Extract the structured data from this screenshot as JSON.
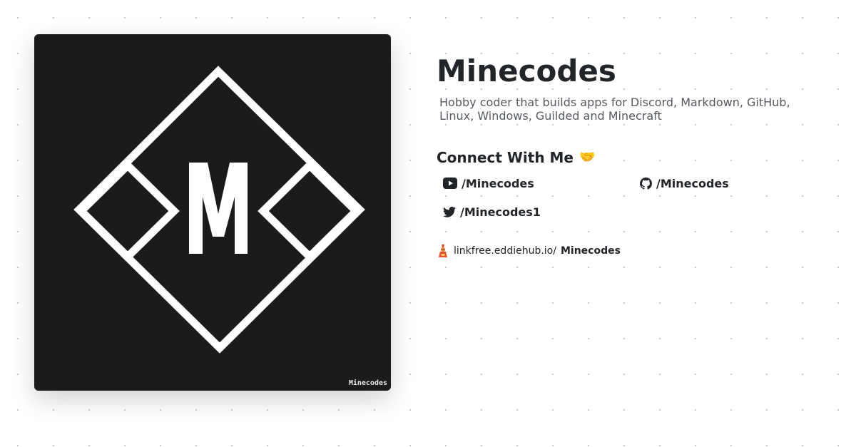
{
  "avatar": {
    "watermark": "Minecodes",
    "logo_letter": "M",
    "background_color": "#1b1b1b",
    "foreground_color": "#ffffff"
  },
  "profile": {
    "name": "Minecodes",
    "bio": "Hobby coder that builds apps for Discord, Markdown, GitHub, Linux, Windows, Guilded and Minecraft"
  },
  "connect": {
    "heading": "Connect With Me",
    "emoji": "🤝",
    "links": [
      {
        "icon": "youtube-icon",
        "label": "/Minecodes"
      },
      {
        "icon": "github-icon",
        "label": "/Minecodes"
      },
      {
        "icon": "twitter-icon",
        "label": "/Minecodes1"
      }
    ]
  },
  "linkfree": {
    "icon": "linkfree-mascot-icon",
    "prefix": "linkfree.eddiehub.io/",
    "username": "Minecodes"
  }
}
